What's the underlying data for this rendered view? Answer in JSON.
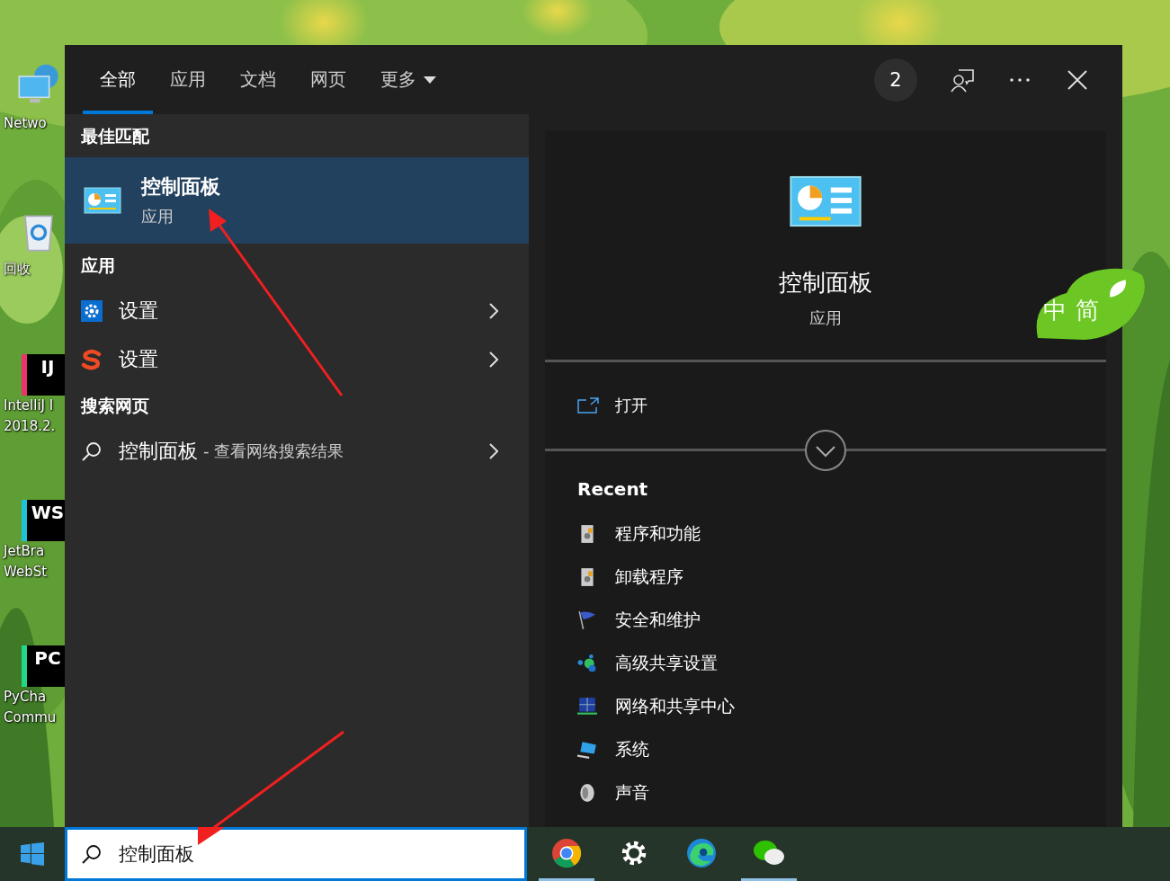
{
  "desktop": {
    "icons": [
      {
        "kind": "network",
        "lines": [
          "Netwo"
        ]
      },
      {
        "kind": "recycle",
        "lines": [
          "回收"
        ]
      },
      {
        "kind": "ide",
        "badge": "IJ",
        "color": "#e8336b",
        "lines": [
          "IntelliJ I",
          "2018.2."
        ]
      },
      {
        "kind": "ide",
        "badge": "WS",
        "color": "#1ec3d8",
        "lines": [
          "JetBra",
          "WebSt"
        ]
      },
      {
        "kind": "ide",
        "badge": "PC",
        "color": "#21d789",
        "lines": [
          "PyCha",
          "Commu"
        ]
      }
    ]
  },
  "search_window": {
    "tabs": [
      {
        "label": "全部",
        "selected": true,
        "dropdown": false
      },
      {
        "label": "应用",
        "selected": false,
        "dropdown": false
      },
      {
        "label": "文档",
        "selected": false,
        "dropdown": false
      },
      {
        "label": "网页",
        "selected": false,
        "dropdown": false
      },
      {
        "label": "更多",
        "selected": false,
        "dropdown": true
      }
    ],
    "reward_count": "2",
    "best_match": {
      "heading": "最佳匹配",
      "title": "控制面板",
      "subtitle": "应用",
      "selected": true
    },
    "apps": {
      "heading": "应用",
      "items": [
        {
          "kind": "gear",
          "label": "设置"
        },
        {
          "kind": "sogou",
          "label": "设置"
        }
      ]
    },
    "web": {
      "heading": "搜索网页",
      "query": "控制面板",
      "suffix": "- 查看网络搜索结果"
    },
    "preview": {
      "title": "控制面板",
      "subtitle": "应用",
      "actions": [
        {
          "label": "打开"
        }
      ],
      "recent_heading": "Recent",
      "recent": [
        {
          "kind": "program",
          "label": "程序和功能"
        },
        {
          "kind": "program",
          "label": "卸载程序"
        },
        {
          "kind": "flag",
          "label": "安全和维护"
        },
        {
          "kind": "dots",
          "label": "高级共享设置"
        },
        {
          "kind": "network",
          "label": "网络和共享中心"
        },
        {
          "kind": "monitor",
          "label": "系统"
        },
        {
          "kind": "speaker",
          "label": "声音"
        }
      ]
    }
  },
  "ime": {
    "mode": "中",
    "script": "简"
  },
  "taskbar": {
    "search_value": "控制面板",
    "apps": [
      {
        "kind": "chrome",
        "running": true
      },
      {
        "kind": "settings",
        "running": false
      },
      {
        "kind": "edge",
        "running": false
      },
      {
        "kind": "wechat",
        "running": true
      }
    ]
  }
}
